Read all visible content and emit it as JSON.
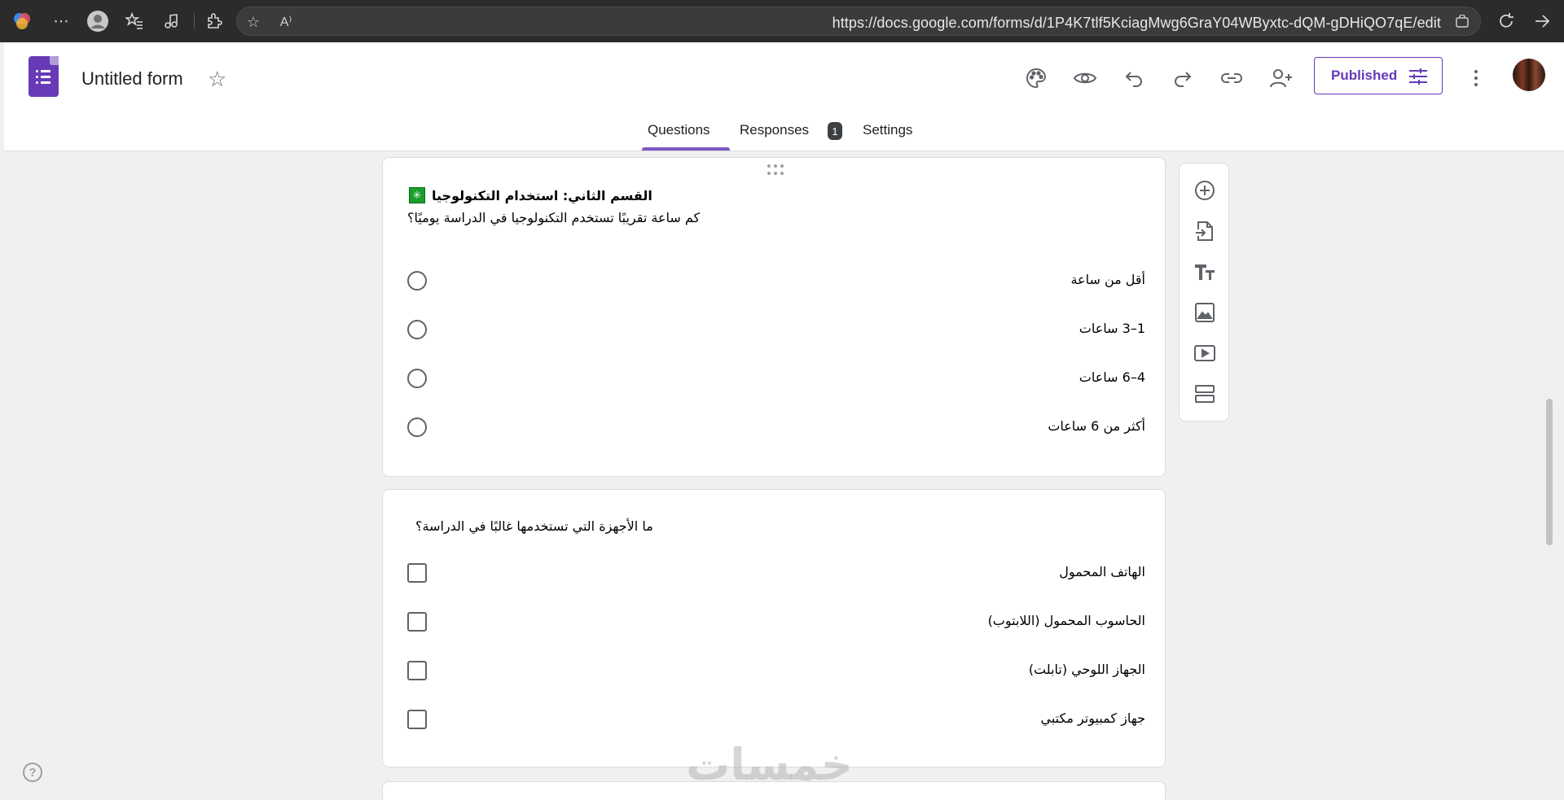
{
  "browser": {
    "url": "https://docs.google.com/forms/d/1P4K7tlf5KciagMwg6GraY04WByxtc-dQM-gDHiQO7qE/edit",
    "read_aloud_label": "A⁾"
  },
  "header": {
    "form_title": "Untitled form",
    "published_label": "Published"
  },
  "tabs": [
    {
      "label": "Questions"
    },
    {
      "label": "Responses",
      "badge": "1"
    },
    {
      "label": "Settings"
    }
  ],
  "section2": {
    "badge": "✳",
    "title": "القسم الثاني: استخدام التكنولوجيا",
    "question": "كم ساعة تقريبًا تستخدم التكنولوجيا في الدراسة يوميًا؟",
    "options": [
      "أقل من ساعة",
      "1–3 ساعات",
      "4–6 ساعات",
      "أكثر من 6 ساعات"
    ]
  },
  "question3": {
    "question": "ما الأجهزة التي تستخدمها غالبًا في الدراسة؟",
    "options": [
      "الهاتف المحمول",
      "الحاسوب المحمول (اللابتوب)",
      "الجهاز اللوحي (تابلت)",
      "جهاز كمبيوتر مكتبي"
    ]
  },
  "help": {
    "label": "?"
  },
  "watermark": "خمسات",
  "colors": {
    "accent": "#673ab7",
    "badge_green": "#1a9d2b"
  }
}
